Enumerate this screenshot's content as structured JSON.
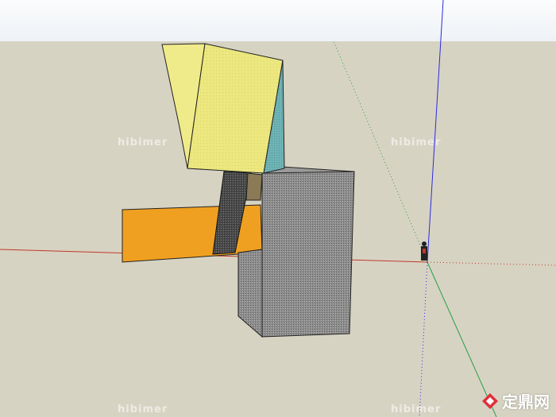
{
  "viewport": {
    "sky_color": "#f4f6f8",
    "ground_color": "#d7d3c3",
    "axis_colors": {
      "x": "#c0392b",
      "y": "#27a043",
      "z": "#2b2be0"
    }
  },
  "watermarks": [
    "hibimer",
    "hibimer",
    "hibimer",
    "hibimer"
  ],
  "logo": {
    "icon": "diamond-logo-icon",
    "text": "定鼎网"
  }
}
